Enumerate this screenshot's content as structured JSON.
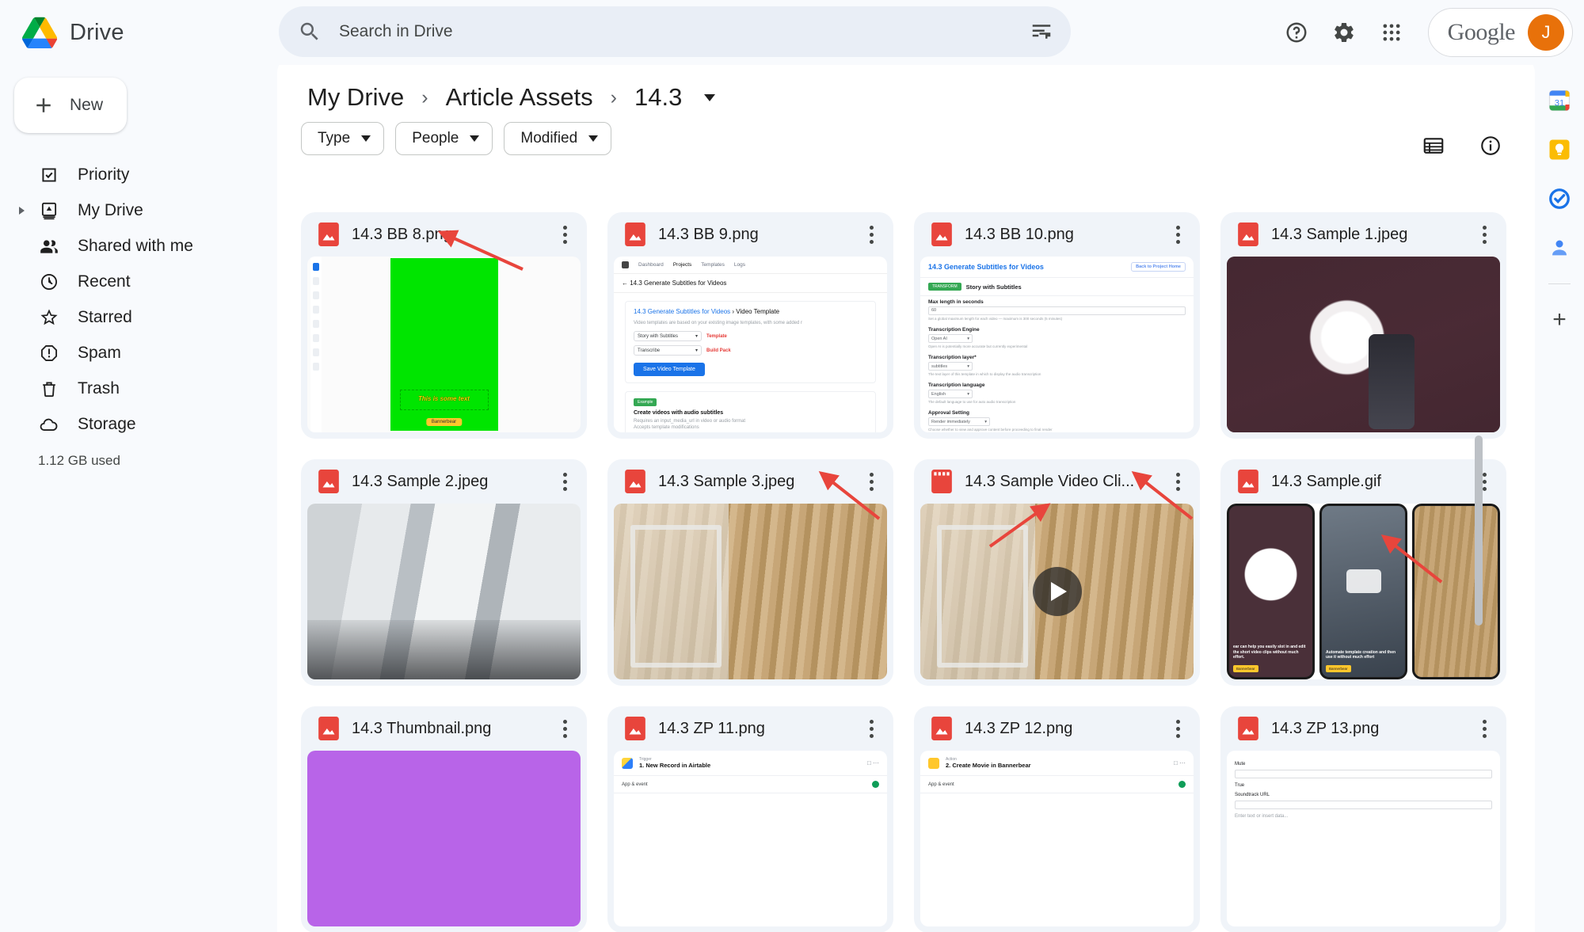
{
  "app": {
    "brand": "Drive",
    "logo_icon": "drive-logo-icon"
  },
  "search": {
    "placeholder": "Search in Drive",
    "value": "",
    "icon": "search-icon",
    "options_icon": "search-options-icon"
  },
  "header": {
    "help_icon": "help-icon",
    "settings_icon": "gear-icon",
    "apps_icon": "apps-grid-icon",
    "account_label": "Google",
    "avatar_initial": "J",
    "avatar_color": "#e8710a"
  },
  "sidebar": {
    "new_button": {
      "label": "New",
      "icon": "plus-icon"
    },
    "items": [
      {
        "label": "Priority",
        "icon": "priority-check-icon",
        "expandable": false
      },
      {
        "label": "My Drive",
        "icon": "my-drive-icon",
        "expandable": true
      },
      {
        "label": "Shared with me",
        "icon": "people-icon",
        "expandable": false
      },
      {
        "label": "Recent",
        "icon": "clock-icon",
        "expandable": false
      },
      {
        "label": "Starred",
        "icon": "star-icon",
        "expandable": false
      },
      {
        "label": "Spam",
        "icon": "spam-icon",
        "expandable": false
      },
      {
        "label": "Trash",
        "icon": "trash-icon",
        "expandable": false
      },
      {
        "label": "Storage",
        "icon": "cloud-icon",
        "expandable": false
      }
    ],
    "storage_used": "1.12 GB used"
  },
  "breadcrumb": {
    "items": [
      "My Drive",
      "Article Assets",
      "14.3"
    ],
    "separator": "›",
    "current_has_caret": true
  },
  "toolbar": {
    "list_view_icon": "list-view-icon",
    "details_icon": "info-icon"
  },
  "filters": [
    {
      "label": "Type",
      "caret": true
    },
    {
      "label": "People",
      "caret": true
    },
    {
      "label": "Modified",
      "caret": true
    }
  ],
  "files": [
    {
      "name": "14.3 BB 8.png",
      "type_icon": "image-file-icon",
      "has_arrow": true
    },
    {
      "name": "14.3 BB 9.png",
      "type_icon": "image-file-icon",
      "has_arrow": true
    },
    {
      "name": "14.3 BB 10.png",
      "type_icon": "image-file-icon",
      "has_arrow": true
    },
    {
      "name": "14.3 Sample 1.jpeg",
      "type_icon": "image-file-icon",
      "has_arrow": false
    },
    {
      "name": "14.3 Sample 2.jpeg",
      "type_icon": "image-file-icon",
      "has_arrow": false
    },
    {
      "name": "14.3 Sample 3.jpeg",
      "type_icon": "image-file-icon",
      "has_arrow": true
    },
    {
      "name": "14.3 Sample Video Cli...",
      "type_icon": "video-file-icon",
      "has_arrow": true
    },
    {
      "name": "14.3 Sample.gif",
      "type_icon": "image-file-icon",
      "has_arrow": true
    },
    {
      "name": "14.3 Thumbnail.png",
      "type_icon": "image-file-icon",
      "has_arrow": false
    },
    {
      "name": "14.3 ZP 11.png",
      "type_icon": "image-file-icon",
      "has_arrow": false
    },
    {
      "name": "14.3 ZP 12.png",
      "type_icon": "image-file-icon",
      "has_arrow": false
    },
    {
      "name": "14.3 ZP 13.png",
      "type_icon": "image-file-icon",
      "has_arrow": false
    }
  ],
  "thumbnails": {
    "bb8": {
      "overlay_text": "This is some text",
      "badge": "Bannerbear"
    },
    "bb9": {
      "nav": [
        "Dashboard",
        "Projects",
        "Templates",
        "Logs"
      ],
      "page_title": "14.3 Generate Subtitles for Videos",
      "card_heading_link": "14.3 Generate Subtitles for Videos",
      "card_heading_rest": "› Video Template",
      "desc": "Video templates are based on your existing image templates, with some added r",
      "select_1": "Story with Subtitles",
      "annot_1": "Template",
      "select_2": "Transcribe",
      "annot_2": "Build Pack",
      "save_button": "Save Video Template",
      "tag": "Example",
      "section_title": "Create videos with audio subtitles",
      "bullet_1": "Requires an input_media_url in video or audio format",
      "bullet_2": "Accepts template modifications"
    },
    "bb10": {
      "title": "14.3 Generate Subtitles for Videos",
      "back_button": "Back to Project Home",
      "tag": "TRANSFORM",
      "template_name": "Story with Subtitles",
      "f1_label": "Max length in seconds",
      "f1_value": "60",
      "f1_hint": "Set a global maximum length for each video — maximum is 300 seconds (5 minutes)",
      "f2_label": "Transcription Engine",
      "f2_value": "Open AI",
      "f2_hint": "Open AI is potentially more accurate but currently experimental",
      "f3_label": "Transcription layer*",
      "f3_value": "subtitles",
      "f3_hint": "The text layer of this template in which to display the audio transcription",
      "f4_label": "Transcription language",
      "f4_value": "English",
      "f4_hint": "The default language to use for auto audio transcription",
      "f5_label": "Approval Setting",
      "f5_value": "Render immediately",
      "f5_hint": "Choose whether to view and approve content before proceeding to final render"
    },
    "video_clip": {
      "play_icon": "play-button-icon"
    },
    "gif": {
      "caption_1": "ear can help you easily slot in and edit the short video clips without much effort.",
      "badge_1": "Bannerbear",
      "caption_2": "Automate template creation and then use it without much effort",
      "badge_2": "Bannerbear"
    },
    "zp11": {
      "kicker": "Trigger",
      "title": "1. New Record in Airtable",
      "sub": "App & event"
    },
    "zp12": {
      "kicker": "Action",
      "title": "2. Create Movie in Bannerbear",
      "sub": "App & event"
    },
    "zp13": {
      "label_1": "Mute",
      "value_1": "True",
      "label_2": "Soundtrack URL",
      "placeholder_2": "Enter text or insert data..."
    }
  },
  "right_rail": {
    "items": [
      {
        "icon": "google-calendar-icon"
      },
      {
        "icon": "google-keep-icon"
      },
      {
        "icon": "google-tasks-icon"
      },
      {
        "icon": "google-contacts-icon"
      }
    ],
    "add_icon": "plus-icon"
  }
}
